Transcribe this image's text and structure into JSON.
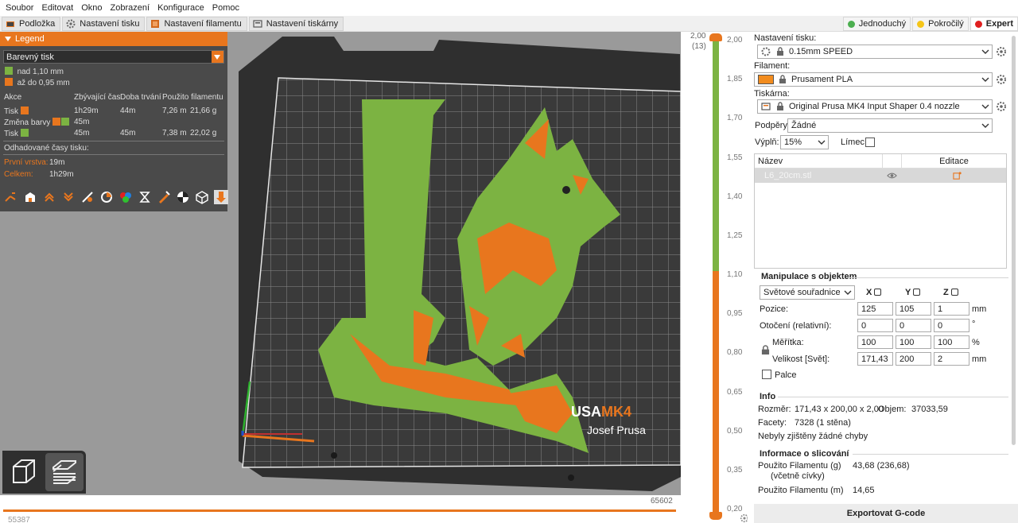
{
  "menu": [
    "Soubor",
    "Editovat",
    "Okno",
    "Zobrazení",
    "Konfigurace",
    "Pomoc"
  ],
  "tabs": [
    {
      "label": "Podložka",
      "icon": "bed-icon"
    },
    {
      "label": "Nastavení tisku",
      "icon": "gear-icon"
    },
    {
      "label": "Nastavení filamentu",
      "icon": "spool-icon"
    },
    {
      "label": "Nastavení tiskárny",
      "icon": "printer-icon"
    }
  ],
  "modes": [
    {
      "label": "Jednoduchý",
      "color": "#4caf50"
    },
    {
      "label": "Pokročilý",
      "color": "#f5c518"
    },
    {
      "label": "Expert",
      "color": "#e02020"
    }
  ],
  "legend": {
    "title": "Legend",
    "view_type": "Barevný tisk",
    "ranges": [
      {
        "label": "nad 1,10 mm",
        "color": "#7cb342"
      },
      {
        "label": "až do 0,95 mm",
        "color": "#e8761e"
      }
    ],
    "columns": [
      "Akce",
      "Zbývající čas",
      "Doba trvání",
      "Použito filamentu"
    ],
    "rows": [
      {
        "action": "Tisk",
        "colors": [
          "#e8761e"
        ],
        "remaining": "1h29m",
        "duration": "44m",
        "length": "7,26 m",
        "weight": "21,66 g"
      },
      {
        "action": "Změna barvy",
        "colors": [
          "#e8761e",
          "#7cb342"
        ],
        "remaining": "45m",
        "duration": "",
        "length": "",
        "weight": ""
      },
      {
        "action": "Tisk",
        "colors": [
          "#7cb342"
        ],
        "remaining": "45m",
        "duration": "45m",
        "length": "7,38 m",
        "weight": "22,02 g"
      }
    ],
    "estimate_title": "Odhadované časy tisku:",
    "first_layer_label": "První vrstva:",
    "first_layer_value": "19m",
    "total_label": "Celkem:",
    "total_value": "1h29m"
  },
  "viewport": {
    "bed_brand": "USA",
    "bed_model": "MK4",
    "bed_maker": "Josef Prusa",
    "h_slider_right": "65602",
    "h_slider_left": "55387"
  },
  "vslider": {
    "top_value": "2,00",
    "top_layer": "(13)",
    "ticks": [
      "2,00",
      "1,85",
      "1,70",
      "1,55",
      "1,40",
      "1,25",
      "1,10",
      "0,95",
      "0,80",
      "0,65",
      "0,50",
      "0,35",
      "0,20"
    ],
    "color_change_height": 1.1,
    "max_height": 2.0,
    "min_height": 0.2
  },
  "sidebar": {
    "print_settings_label": "Nastavení tisku:",
    "print_settings_value": "0.15mm SPEED",
    "filament_label": "Filament:",
    "filament_value": "Prusament PLA",
    "filament_color": "#f28c1e",
    "printer_label": "Tiskárna:",
    "printer_value": "Original Prusa MK4 Input Shaper 0.4 nozzle",
    "supports_label": "Podpěry:",
    "supports_value": "Žádné",
    "infill_label": "Výplň:",
    "infill_value": "15%",
    "brim_label": "Límec:",
    "list_name_header": "Název",
    "list_edit_header": "Editace",
    "object_name": "L6_20cm.stl",
    "manip_title": "Manipulace s objektem",
    "coord_system": "Světové souřadnice",
    "axis_x": "X",
    "axis_y": "Y",
    "axis_z": "Z",
    "position_label": "Pozice:",
    "position": [
      "125",
      "105",
      "1"
    ],
    "position_unit": "mm",
    "rotation_label": "Otočení (relativní):",
    "rotation": [
      "0",
      "0",
      "0"
    ],
    "rotation_unit": "°",
    "scale_label": "Měřítka:",
    "scale": [
      "100",
      "100",
      "100"
    ],
    "scale_unit": "%",
    "size_label": "Velikost [Svět]:",
    "size": [
      "171,43",
      "200",
      "2"
    ],
    "size_unit": "mm",
    "inches_label": "Palce",
    "info_title": "Info",
    "size_info_label": "Rozměr:",
    "size_info_value": "171,43 x 200,00 x 2,00",
    "volume_label": "Objem:",
    "volume_value": "37033,59",
    "facets_label": "Facety:",
    "facets_value": "7328 (1 stěna)",
    "errors_text": "Nebyly zjištěny žádné chyby",
    "slice_title": "Informace o slicování",
    "filament_g_label": "Použito Filamentu (g)",
    "filament_g_sub": "(včetně cívky)",
    "filament_g_value": "43,68 (236,68)",
    "filament_m_label": "Použito Filamentu (m)",
    "filament_m_value": "14,65",
    "export_label": "Exportovat G-code"
  }
}
